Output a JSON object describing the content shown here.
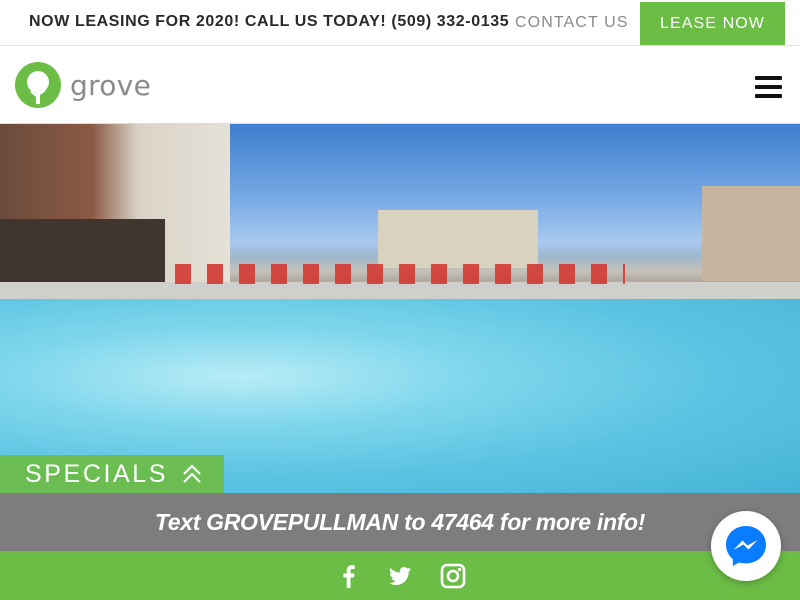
{
  "topbar": {
    "promo": "NOW LEASING FOR 2020! CALL US TODAY! (509) 332-0135",
    "contact_label": "CONTACT US",
    "lease_label": "LEASE NOW"
  },
  "navbar": {
    "logo_text": "grove",
    "menu_icon": "hamburger-menu-icon"
  },
  "hero": {
    "image_subject": "pool"
  },
  "specials": {
    "label": "SPECIALS",
    "icon": "double-chevron-up-icon"
  },
  "text_bar": {
    "message": "Text GROVEPULLMAN to 47464 for more info!"
  },
  "footer": {
    "social": [
      "facebook-icon",
      "twitter-icon",
      "instagram-icon"
    ]
  },
  "chat": {
    "icon": "messenger-icon"
  },
  "colors": {
    "brand_green": "#6cbd45",
    "gray_bar": "#7d7d7d",
    "messenger_blue": "#0a7cff"
  }
}
